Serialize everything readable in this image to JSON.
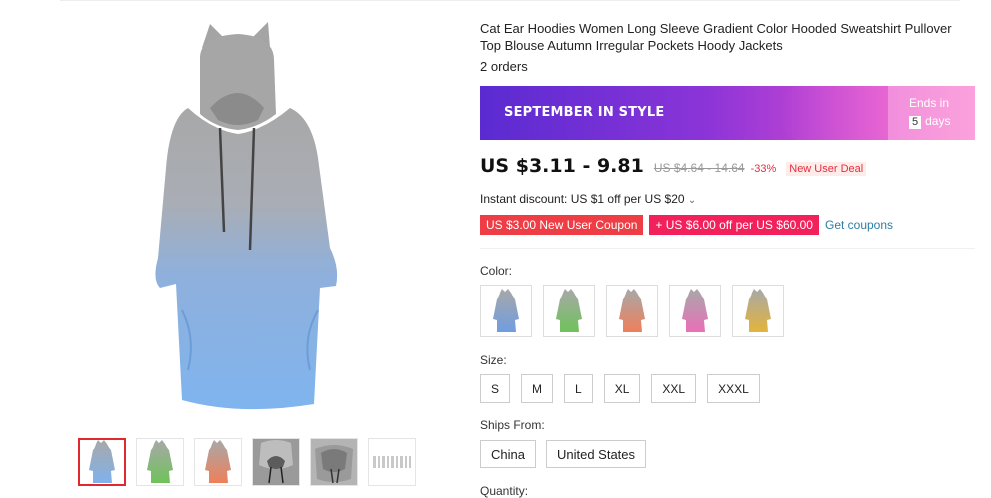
{
  "product": {
    "title": "Cat Ear Hoodies Women Long Sleeve Gradient Color Hooded Sweatshirt Pullover Top Blouse Autumn Irregular Pockets Hoody Jackets",
    "orders": "2 orders"
  },
  "banner": {
    "label": "SEPTEMBER IN STYLE",
    "ends_prefix": "Ends in",
    "ends_days": "5",
    "ends_suffix": "days"
  },
  "price": {
    "current": "US $3.11 - 9.81",
    "original": "US $4.64 - 14.64",
    "discount": "-33%",
    "deal": "New User Deal"
  },
  "instant_discount": "Instant discount: US $1 off per US $20",
  "coupons": {
    "coupon1": "US $3.00 New User Coupon",
    "coupon2": "+ US $6.00 off per US $60.00",
    "get": "Get coupons"
  },
  "color": {
    "label": "Color:",
    "options": [
      "blue",
      "green",
      "orange",
      "pink",
      "yellow"
    ],
    "hex": [
      "#6f9de0",
      "#6fc25a",
      "#ef7f5a",
      "#ea6fb8",
      "#e3b43a"
    ]
  },
  "size": {
    "label": "Size:",
    "options": [
      "S",
      "M",
      "L",
      "XL",
      "XXL",
      "XXXL"
    ]
  },
  "ships": {
    "label": "Ships From:",
    "options": [
      "China",
      "United States"
    ]
  },
  "quantity_label": "Quantity:",
  "thumbnails": [
    "blue",
    "green",
    "orange",
    "hood-detail",
    "hood-detail-2",
    "size-chart"
  ],
  "colors": {
    "accent": "#e62e3c",
    "link": "#2e7ea6",
    "grey_top": "#a9a9a9",
    "blue_bottom": "#7fb2ec"
  }
}
